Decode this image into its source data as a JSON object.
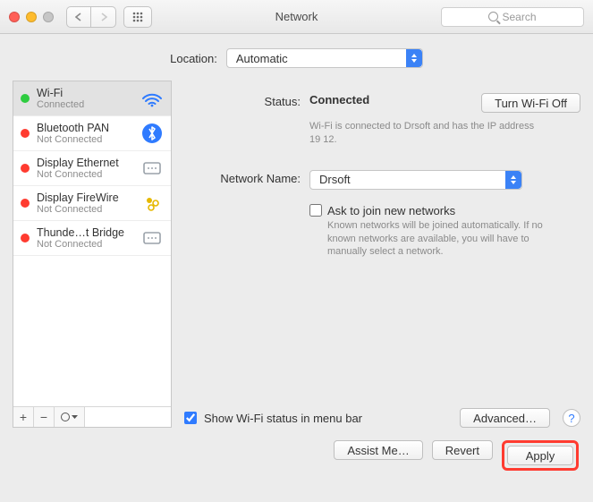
{
  "window": {
    "title": "Network",
    "search_placeholder": "Search"
  },
  "location": {
    "label": "Location:",
    "value": "Automatic"
  },
  "sidebar": {
    "items": [
      {
        "name": "Wi-Fi",
        "sub": "Connected",
        "status": "green",
        "icon": "wifi"
      },
      {
        "name": "Bluetooth PAN",
        "sub": "Not Connected",
        "status": "red",
        "icon": "bluetooth"
      },
      {
        "name": "Display Ethernet",
        "sub": "Not Connected",
        "status": "red",
        "icon": "ethernet"
      },
      {
        "name": "Display FireWire",
        "sub": "Not Connected",
        "status": "red",
        "icon": "firewire"
      },
      {
        "name": "Thunde…t Bridge",
        "sub": "Not Connected",
        "status": "red",
        "icon": "ethernet"
      }
    ],
    "footer": {
      "add": "+",
      "remove": "−",
      "gear": ""
    }
  },
  "detail": {
    "status_label": "Status:",
    "status_value": "Connected",
    "turn_off": "Turn Wi-Fi Off",
    "status_sub": "Wi-Fi is connected to Drsoft and has the IP address 19            12.",
    "network_name_label": "Network Name:",
    "network_name_value": "Drsoft",
    "ask_join_label": "Ask to join new networks",
    "ask_join_sub": "Known networks will be joined automatically. If no known networks are available, you will have to manually select a network.",
    "show_status_label": "Show Wi-Fi status in menu bar",
    "advanced": "Advanced…"
  },
  "footer": {
    "assist": "Assist Me…",
    "revert": "Revert",
    "apply": "Apply"
  }
}
